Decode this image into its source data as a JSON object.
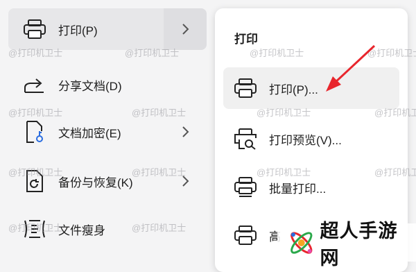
{
  "left_menu": {
    "items": [
      {
        "label": "打印(P)",
        "icon": "printer-icon",
        "has_submenu": true,
        "active": true
      },
      {
        "label": "分享文档(D)",
        "icon": "share-icon",
        "has_submenu": false
      },
      {
        "label": "文档加密(E)",
        "icon": "encrypt-doc-icon",
        "has_submenu": true
      },
      {
        "label": "备份与恢复(K)",
        "icon": "backup-restore-icon",
        "has_submenu": true
      },
      {
        "label": "文件瘦身",
        "icon": "file-slim-icon",
        "has_submenu": false
      }
    ]
  },
  "submenu": {
    "title": "打印",
    "items": [
      {
        "label": "打印(P)...",
        "icon": "printer-icon",
        "hover": true
      },
      {
        "label": "打印预览(V)...",
        "icon": "print-preview-icon"
      },
      {
        "label": "批量打印...",
        "icon": "batch-print-icon"
      },
      {
        "label": "高",
        "icon": "printer-icon"
      }
    ]
  },
  "watermark": "@打印机卫士",
  "brand": {
    "text": "超人手游网"
  },
  "colors": {
    "arrow": "#e8262d",
    "active_bg": "#e7e7e9",
    "hover_bg": "#f0f0f0"
  }
}
